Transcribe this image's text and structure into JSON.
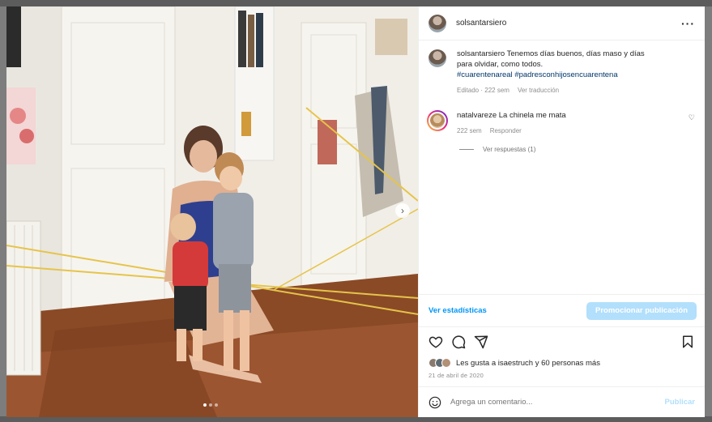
{
  "post": {
    "username": "solsantarsiero",
    "caption_user": "solsantarsiero",
    "caption_text": "Tenemos días buenos, días maso y días para olvidar, como todos.",
    "hashtags": [
      "#cuarentenareal",
      "#padresconhijosencuarentena"
    ],
    "edited_label": "Editado · 222 sem",
    "translate_label": "Ver traducción",
    "date": "21 de abril de 2020",
    "carousel": {
      "count": 3,
      "active_index": 0
    }
  },
  "comments": [
    {
      "user": "natalvareze",
      "text": "La chinela me mata",
      "time": "222 sem",
      "reply_label": "Responder",
      "view_replies": "Ver respuestas (1)"
    }
  ],
  "stats_bar": {
    "stats_link": "Ver estadísticas",
    "promote_button": "Promocionar publicación"
  },
  "likes": {
    "text": "Les gusta a isaestruch y 60 personas más"
  },
  "add_comment": {
    "placeholder": "Agrega un comentario...",
    "publish": "Publicar"
  },
  "icons": {
    "more": "more-options-icon",
    "heart": "heart-icon",
    "comment": "comment-icon",
    "share": "share-icon",
    "save": "bookmark-icon",
    "emoji": "emoji-icon",
    "next": "chevron-right-icon"
  },
  "colors": {
    "link_blue": "#0095f6",
    "hashtag_blue": "#00376b",
    "promote_bg": "#b2dffc"
  }
}
